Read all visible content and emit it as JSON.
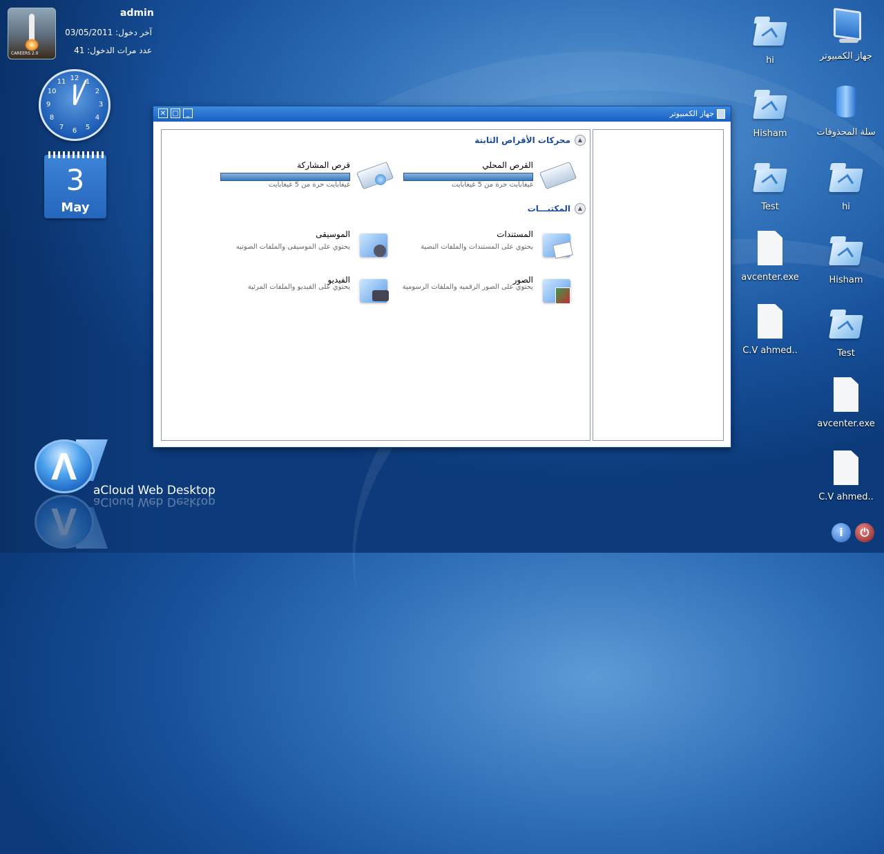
{
  "user": {
    "name": "admin",
    "last_login_label": "آخر دخول:",
    "last_login_value": "03/05/2011",
    "login_count_label": "عدد مرات الدخول:",
    "login_count_value": "41",
    "avatar_caption": "CAREERS 2.0"
  },
  "clock": {
    "numbers": [
      "12",
      "1",
      "2",
      "3",
      "4",
      "5",
      "6",
      "7",
      "8",
      "9",
      "10",
      "11"
    ],
    "hour": 12,
    "minute": 2
  },
  "calendar": {
    "day": "3",
    "month": "May"
  },
  "brand": {
    "name": "aCloud Web Desktop"
  },
  "desktop_icons": [
    {
      "label": "جهاز الكمبيوتر",
      "icon": "computer-icon"
    },
    {
      "label": "hi",
      "icon": "folder-icon"
    },
    {
      "label": "سلة المحذوفات",
      "icon": "recycle-bin-icon"
    },
    {
      "label": "Hisham",
      "icon": "folder-icon"
    },
    {
      "label": "hi",
      "icon": "folder-icon"
    },
    {
      "label": "Test",
      "icon": "folder-icon"
    },
    {
      "label": "Hisham",
      "icon": "folder-icon"
    },
    {
      "label": "avcenter.exe",
      "icon": "file-icon"
    },
    {
      "label": "Test",
      "icon": "folder-icon"
    },
    {
      "label": "C.V ahmed..",
      "icon": "file-icon"
    },
    {
      "label": "avcenter.exe",
      "icon": "file-icon"
    },
    {
      "label": "C.V ahmed..",
      "icon": "file-icon"
    }
  ],
  "window": {
    "title": "جهاز الكمبيوتر",
    "sections": {
      "drives": "محركات الأقراص الثابتة",
      "libraries": "المكتبـــات"
    },
    "drives": [
      {
        "title": "القرص المحلي",
        "desc": "غيغابايت حرة من 5 غيغابايت",
        "usage": 1.0
      },
      {
        "title": "قرص المشاركة",
        "desc": "غيغابايت حرة من 5 غيغابايت",
        "usage": 1.0
      }
    ],
    "libraries": [
      {
        "title": "المستندات",
        "desc": "يحتوي على المستندات والملفات النصية",
        "icon": "documents-folder-icon"
      },
      {
        "title": "الموسيقى",
        "desc": "يحتوي على الموسيقى والملفات الصوتيه",
        "icon": "music-folder-icon"
      },
      {
        "title": "الصور",
        "desc": "يحتوي على الصور الرقميه والملفات الرسومية",
        "icon": "pictures-folder-icon"
      },
      {
        "title": "الفيديو",
        "desc": "يحتوي على الفيديو والملفات المرئية",
        "icon": "video-folder-icon"
      }
    ]
  },
  "system_buttons": {
    "info": "i",
    "power": "⏻"
  }
}
